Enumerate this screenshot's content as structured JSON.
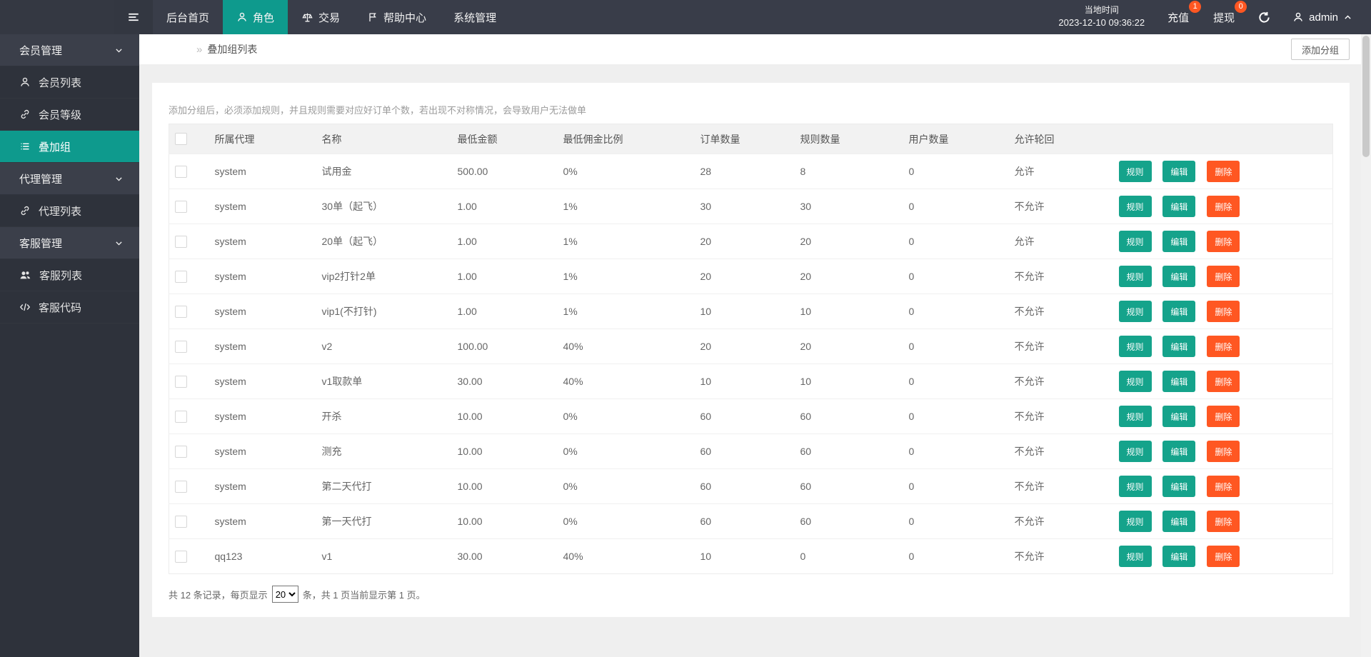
{
  "colors": {
    "accent": "#0e9a8d",
    "button_teal": "#15a38b",
    "button_orange": "#ff5722",
    "badge_red": "#ff5722",
    "nav_bg": "#393d49",
    "sidebar_bg": "#2e323b",
    "sidebar_group_bg": "#3b3f4a"
  },
  "nav": {
    "items": [
      {
        "label": "后台首页"
      },
      {
        "label": "角色",
        "icon": "user-icon",
        "active": true
      },
      {
        "label": "交易",
        "icon": "scales-icon"
      },
      {
        "label": "帮助中心",
        "icon": "flag-icon"
      },
      {
        "label": "系统管理"
      }
    ],
    "time": {
      "label": "当地时间",
      "value": "2023-12-10 09:36:22"
    },
    "recharge": {
      "label": "充值",
      "badge": "1"
    },
    "withdraw": {
      "label": "提现",
      "badge": "0"
    },
    "user": {
      "name": "admin"
    }
  },
  "sidebar": {
    "items": [
      {
        "type": "group",
        "label": "会员管理"
      },
      {
        "type": "item",
        "label": "会员列表",
        "icon": "user-icon"
      },
      {
        "type": "item",
        "label": "会员等级",
        "icon": "link-icon"
      },
      {
        "type": "item",
        "label": "叠加组",
        "icon": "list-icon",
        "active": true
      },
      {
        "type": "group",
        "label": "代理管理"
      },
      {
        "type": "item",
        "label": "代理列表",
        "icon": "link-icon"
      },
      {
        "type": "group",
        "label": "客服管理"
      },
      {
        "type": "item",
        "label": "客服列表",
        "icon": "people-icon"
      },
      {
        "type": "item",
        "label": "客服代码",
        "icon": "code-icon"
      }
    ]
  },
  "breadcrumb": {
    "separator": "»",
    "title": "叠加组列表"
  },
  "toolbar": {
    "add_group_label": "添加分组"
  },
  "main": {
    "hint": "添加分组后，必须添加规则，并且规则需要对应好订单个数，若出现不对称情况，会导致用户无法做单",
    "table": {
      "columns": [
        "所属代理",
        "名称",
        "最低金额",
        "最低佣金比例",
        "订单数量",
        "规则数量",
        "用户数量",
        "允许轮回"
      ],
      "rows": [
        [
          "system",
          "试用金",
          "500.00",
          "0%",
          "28",
          "8",
          "0",
          "允许"
        ],
        [
          "system",
          "30单（起飞）",
          "1.00",
          "1%",
          "30",
          "30",
          "0",
          "不允许"
        ],
        [
          "system",
          "20单（起飞）",
          "1.00",
          "1%",
          "20",
          "20",
          "0",
          "允许"
        ],
        [
          "system",
          "vip2打针2单",
          "1.00",
          "1%",
          "20",
          "20",
          "0",
          "不允许"
        ],
        [
          "system",
          "vip1(不打针)",
          "1.00",
          "1%",
          "10",
          "10",
          "0",
          "不允许"
        ],
        [
          "system",
          "v2",
          "100.00",
          "40%",
          "20",
          "20",
          "0",
          "不允许"
        ],
        [
          "system",
          "v1取款单",
          "30.00",
          "40%",
          "10",
          "10",
          "0",
          "不允许"
        ],
        [
          "system",
          "开杀",
          "10.00",
          "0%",
          "60",
          "60",
          "0",
          "不允许"
        ],
        [
          "system",
          "测充",
          "10.00",
          "0%",
          "60",
          "60",
          "0",
          "不允许"
        ],
        [
          "system",
          "第二天代打",
          "10.00",
          "0%",
          "60",
          "60",
          "0",
          "不允许"
        ],
        [
          "system",
          "第一天代打",
          "10.00",
          "0%",
          "60",
          "60",
          "0",
          "不允许"
        ],
        [
          "qq123",
          "v1",
          "30.00",
          "40%",
          "10",
          "0",
          "0",
          "不允许"
        ]
      ],
      "actions": {
        "rule": "规则",
        "edit": "编辑",
        "delete": "删除"
      }
    },
    "pagination": {
      "prefix": "共 12 条记录，每页显示",
      "page_size": "20",
      "suffix": "条，共 1 页当前显示第 1 页。"
    }
  }
}
